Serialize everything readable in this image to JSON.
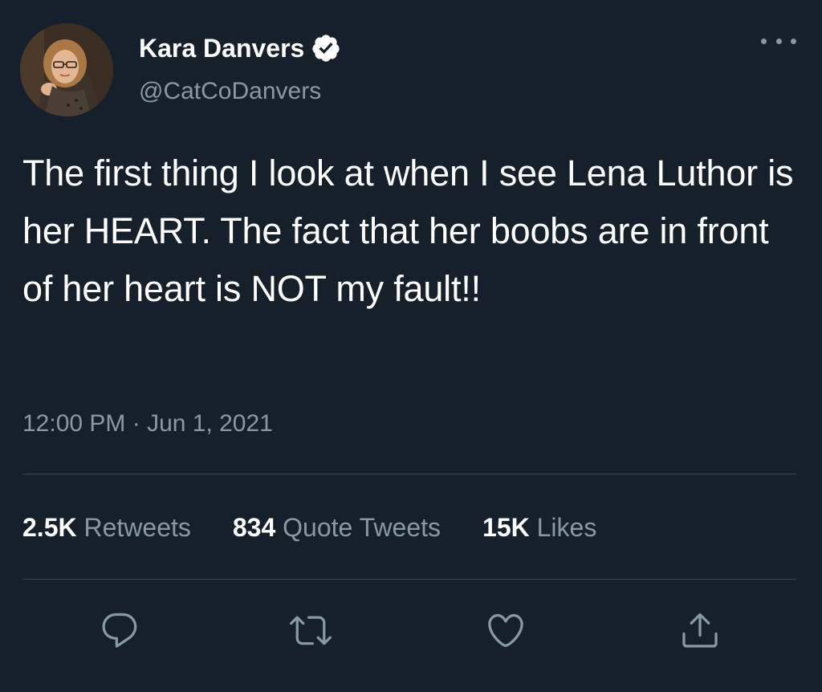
{
  "author": {
    "display_name": "Kara Danvers",
    "handle": "@CatCoDanvers",
    "verified": true,
    "avatar_icon": "profile-photo"
  },
  "tweet": {
    "text": "The first thing I look at when I see Lena Luthor is her HEART. The fact that her boobs are in front of her heart is NOT my fault!!",
    "timestamp": "12:00 PM · Jun 1, 2021"
  },
  "stats": [
    {
      "count": "2.5K",
      "label": "Retweets"
    },
    {
      "count": "834",
      "label": "Quote Tweets"
    },
    {
      "count": "15K",
      "label": "Likes"
    }
  ],
  "actions": [
    {
      "icon": "reply-icon"
    },
    {
      "icon": "retweet-icon"
    },
    {
      "icon": "like-icon"
    },
    {
      "icon": "share-icon"
    }
  ],
  "colors": {
    "background": "#15202b",
    "primary_text": "#ffffff",
    "secondary_text": "#8899a6",
    "divider": "#38444d"
  }
}
